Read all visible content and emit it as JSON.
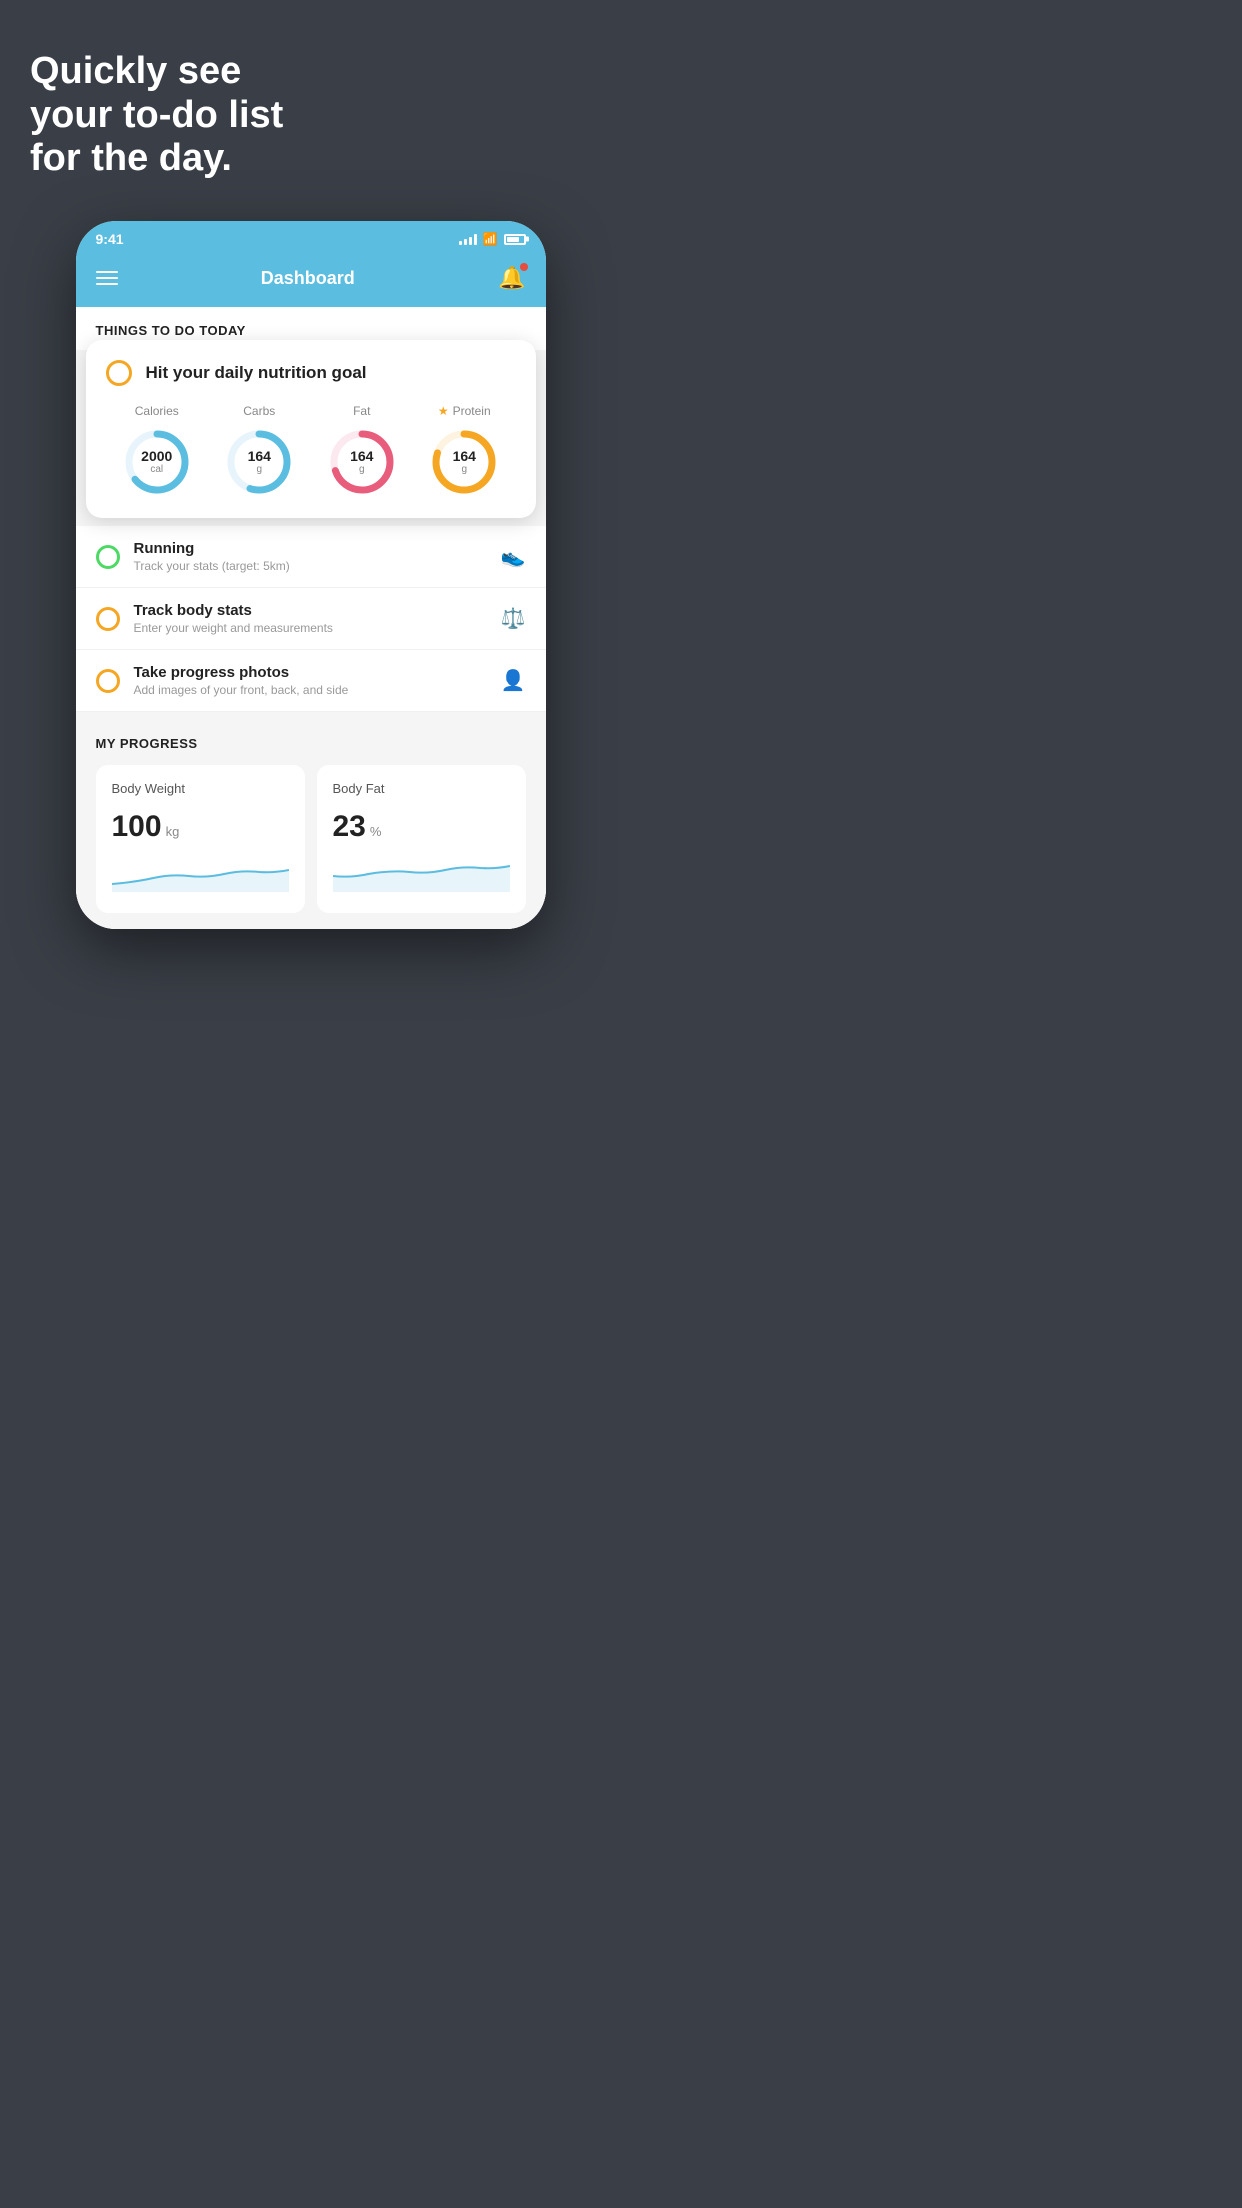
{
  "page": {
    "background_color": "#3a3f47",
    "headline": "Quickly see\nyour to-do list\nfor the day."
  },
  "phone": {
    "status_bar": {
      "time": "9:41",
      "signal_bars": 4,
      "battery_percent": 75
    },
    "header": {
      "title": "Dashboard",
      "menu_label": "menu",
      "bell_label": "notifications"
    },
    "things_today_label": "THINGS TO DO TODAY",
    "floating_card": {
      "check_label": "hit-nutrition-goal-check",
      "title": "Hit your daily nutrition goal",
      "nutrition": [
        {
          "label": "Calories",
          "value": "2000",
          "unit": "cal",
          "color": "#5bbde0",
          "percent": 65,
          "starred": false
        },
        {
          "label": "Carbs",
          "value": "164",
          "unit": "g",
          "color": "#5bbde0",
          "percent": 55,
          "starred": false
        },
        {
          "label": "Fat",
          "value": "164",
          "unit": "g",
          "color": "#e85d7c",
          "percent": 70,
          "starred": false
        },
        {
          "label": "Protein",
          "value": "164",
          "unit": "g",
          "color": "#f5a623",
          "percent": 80,
          "starred": true
        }
      ]
    },
    "todo_items": [
      {
        "id": "running",
        "title": "Running",
        "subtitle": "Track your stats (target: 5km)",
        "circle_color": "green",
        "icon": "shoe"
      },
      {
        "id": "body-stats",
        "title": "Track body stats",
        "subtitle": "Enter your weight and measurements",
        "circle_color": "yellow",
        "icon": "scale"
      },
      {
        "id": "progress-photos",
        "title": "Take progress photos",
        "subtitle": "Add images of your front, back, and side",
        "circle_color": "yellow",
        "icon": "person"
      }
    ],
    "progress_section": {
      "title": "MY PROGRESS",
      "cards": [
        {
          "id": "body-weight",
          "title": "Body Weight",
          "value": "100",
          "unit": "kg"
        },
        {
          "id": "body-fat",
          "title": "Body Fat",
          "value": "23",
          "unit": "%"
        }
      ]
    }
  }
}
